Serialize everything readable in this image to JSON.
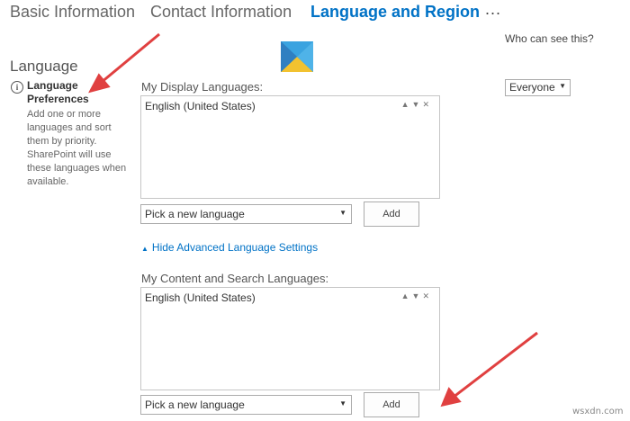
{
  "tabs": [
    {
      "label": "Basic Information"
    },
    {
      "label": "Contact Information"
    },
    {
      "label": "Language and Region"
    }
  ],
  "tab_more_label": "...",
  "section": {
    "title": "Language",
    "pref_title": "Language Preferences",
    "pref_description": "Add one or more languages and sort them by priority. SharePoint will use these languages when available."
  },
  "privacy": {
    "label": "Who can see this?",
    "selected": "Everyone"
  },
  "display_languages": {
    "label": "My Display Languages:",
    "items": [
      "English (United States)"
    ],
    "picker": "Pick a new language",
    "add_label": "Add"
  },
  "advanced_toggle": "Hide Advanced Language Settings",
  "content_languages": {
    "label": "My Content and Search Languages:",
    "items": [
      "English (United States)"
    ],
    "picker": "Pick a new language",
    "add_label": "Add"
  },
  "icons": {
    "up": "▲",
    "down": "▼",
    "remove": "✕",
    "info": "i",
    "dropdown": "▼",
    "collapse": "▲"
  },
  "colors": {
    "accent": "#0072c6",
    "annotation_arrow": "#e04040"
  },
  "watermark": "wsxdn.com"
}
